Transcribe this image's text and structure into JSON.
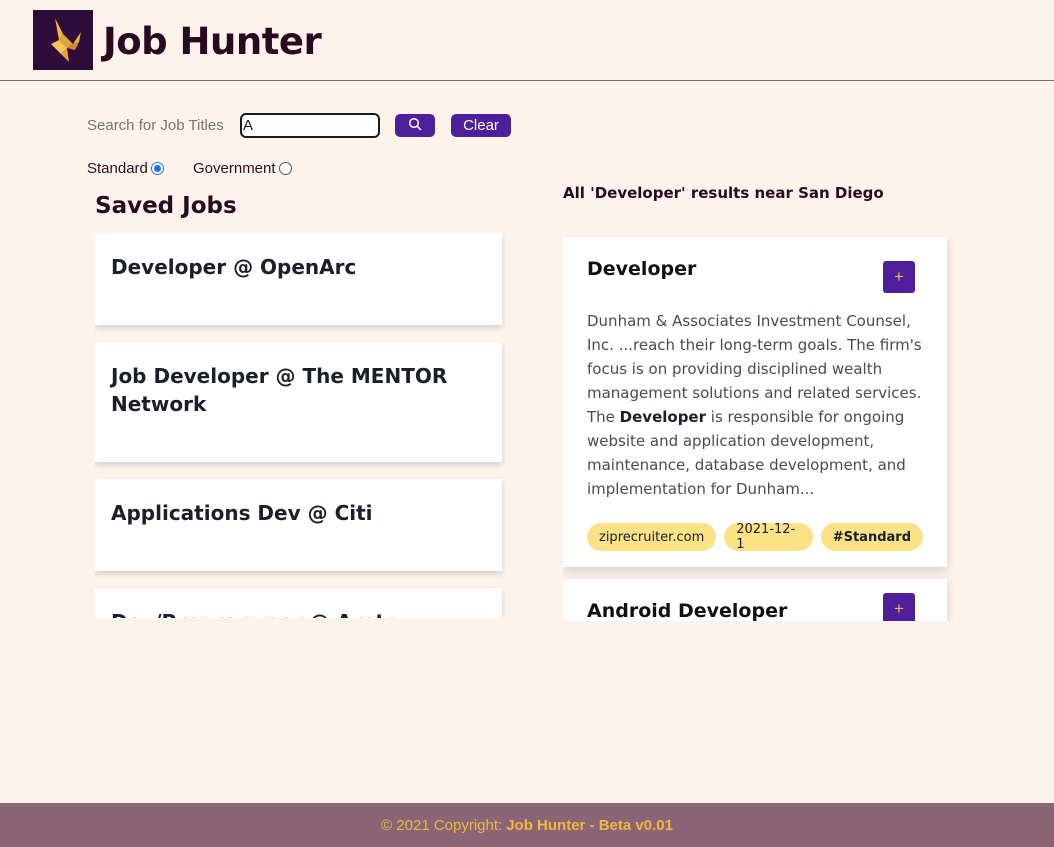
{
  "app": {
    "title": "Job Hunter",
    "logo_icon": "crane-logo-icon"
  },
  "search": {
    "label_placeholder": "Search for Job Titles",
    "value": "A",
    "search_icon": "search-icon",
    "clear_label": "Clear"
  },
  "types": {
    "standard_label": "Standard",
    "government_label": "Government",
    "selected": "Standard"
  },
  "saved": {
    "title": "Saved Jobs",
    "items": [
      "Developer @ OpenArc",
      "Job Developer @ The MENTOR Network",
      "Applications Dev @ Citi",
      "Dev/Programmer @ Arete Technologies"
    ]
  },
  "results": {
    "title": "All 'Developer' results near San Diego",
    "items": [
      {
        "title": "Developer",
        "add_label": "+",
        "desc_before": "Dunham & Associates Investment Counsel, Inc.  ...reach their long-term goals. The firm's focus is on providing disciplined wealth management solutions and related services. The ",
        "desc_bold": "Developer",
        "desc_after": " is responsible for ongoing website and application development, maintenance, database development, and implementation for Dunham...",
        "tags": [
          "ziprecruiter.com",
          "2021-12-1",
          "#Standard"
        ]
      },
      {
        "title": "Android Developer",
        "add_label": "+"
      }
    ]
  },
  "footer": {
    "prefix": "© 2021 Copyright:",
    "brand": "Job Hunter - Beta v0.01"
  },
  "colors": {
    "background": "#fdf3eb",
    "accent": "#4e1f9a",
    "tag": "#fbe287",
    "footer": "#8a6575",
    "footer_text": "#f2b642"
  }
}
